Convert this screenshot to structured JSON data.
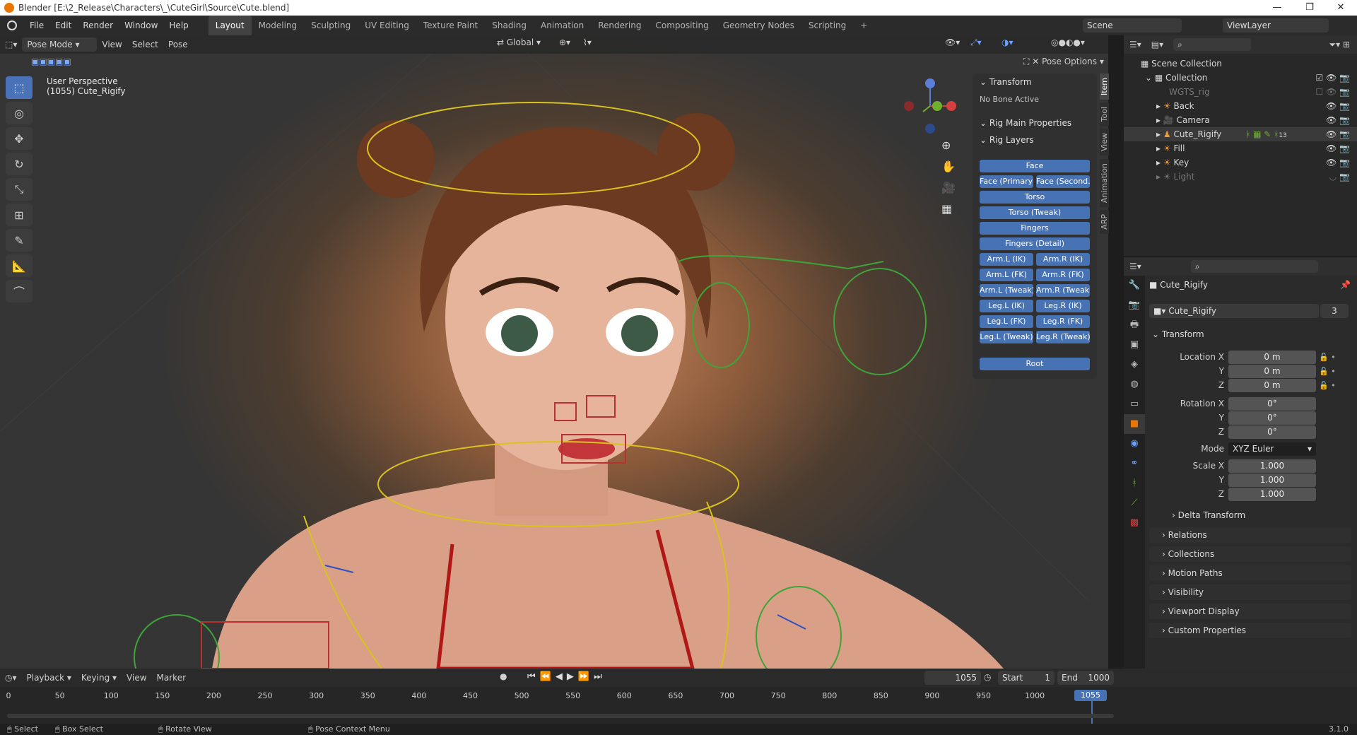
{
  "titlebar": {
    "title": "Blender [E:\\2_Release\\Characters\\_\\CuteGirl\\Source\\Cute.blend]"
  },
  "menu": [
    "File",
    "Edit",
    "Render",
    "Window",
    "Help"
  ],
  "workspaces": [
    "Layout",
    "Modeling",
    "Sculpting",
    "UV Editing",
    "Texture Paint",
    "Shading",
    "Animation",
    "Rendering",
    "Compositing",
    "Geometry Nodes",
    "Scripting",
    "+"
  ],
  "scene": {
    "label": "Scene",
    "viewlayer": "ViewLayer"
  },
  "viewport": {
    "mode": "Pose Mode",
    "menus": [
      "View",
      "Select",
      "Pose"
    ],
    "orientation": "Global",
    "perspective": "User Perspective",
    "object": "(1055) Cute_Rigify",
    "pose_options": "Pose Options"
  },
  "npanel": {
    "transform_title": "Transform",
    "no_bone": "No Bone Active",
    "rig_main": "Rig Main Properties",
    "rig_layers": "Rig Layers",
    "tabs": [
      "Item",
      "Tool",
      "View",
      "Animation",
      "ARP"
    ],
    "buttons": [
      "Face",
      "Face (Primary)",
      "Face (Second...",
      "Torso",
      "Torso (Tweak)",
      "Fingers",
      "Fingers (Detail)",
      "Arm.L (IK)",
      "Arm.R (IK)",
      "Arm.L (FK)",
      "Arm.R (FK)",
      "Arm.L (Tweak)",
      "Arm.R (Tweak)",
      "Leg.L (IK)",
      "Leg.R (IK)",
      "Leg.L (FK)",
      "Leg.R (FK)",
      "Leg.L (Tweak)",
      "Leg.R (Tweak)",
      "Root"
    ]
  },
  "outliner": {
    "scene_collection": "Scene Collection",
    "collection": "Collection",
    "items": [
      "WGTS_rig",
      "Back",
      "Camera",
      "Cute_Rigify",
      "Fill",
      "Key",
      "Light"
    ],
    "badge": "13"
  },
  "properties": {
    "object_name": "Cute_Rigify",
    "data_name": "Cute_Rigify",
    "users": "3",
    "transform": "Transform",
    "location_label": "Location X",
    "rotation_label": "Rotation X",
    "scale_label": "Scale X",
    "y": "Y",
    "z": "Z",
    "loc": [
      "0 m",
      "0 m",
      "0 m"
    ],
    "rot": [
      "0°",
      "0°",
      "0°"
    ],
    "mode_label": "Mode",
    "mode": "XYZ Euler",
    "scale": [
      "1.000",
      "1.000",
      "1.000"
    ],
    "sections": [
      "Delta Transform",
      "Relations",
      "Collections",
      "Motion Paths",
      "Visibility",
      "Viewport Display",
      "Custom Properties"
    ]
  },
  "timeline": {
    "menus": [
      "Playback",
      "Keying",
      "View",
      "Marker"
    ],
    "current": "1055",
    "start_label": "Start",
    "start": "1",
    "end_label": "End",
    "end": "1000",
    "ticks": [
      "0",
      "50",
      "100",
      "150",
      "200",
      "250",
      "300",
      "350",
      "400",
      "450",
      "500",
      "550",
      "600",
      "650",
      "700",
      "750",
      "800",
      "850",
      "900",
      "950",
      "1000",
      "1055"
    ]
  },
  "status": {
    "select": "Select",
    "box": "Box Select",
    "rotate": "Rotate View",
    "pose_menu": "Pose Context Menu",
    "version": "3.1.0"
  },
  "colors": {
    "accent": "#4772b3",
    "bg": "#1d1d1d",
    "orange": "#ea7600"
  }
}
